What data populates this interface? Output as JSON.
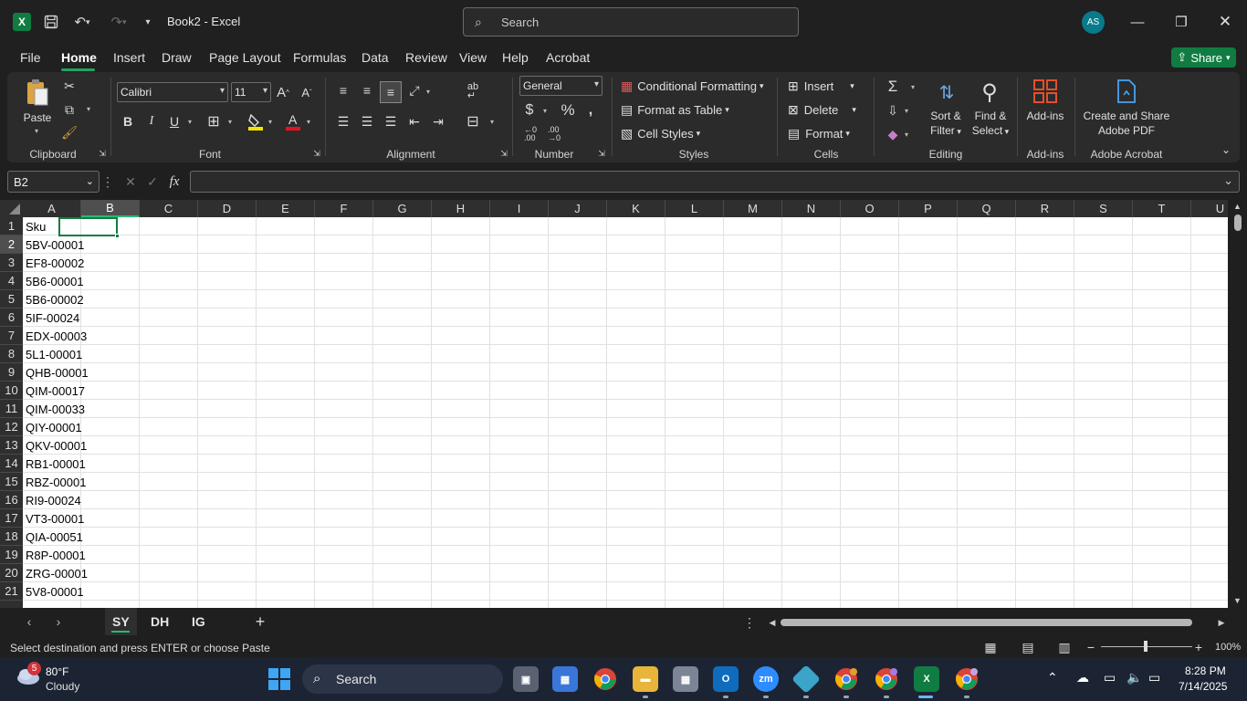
{
  "titlebar": {
    "doc_title": "Book2 - Excel",
    "search_placeholder": "Search",
    "avatar_initials": "AS"
  },
  "menu": {
    "tabs": [
      "File",
      "Home",
      "Insert",
      "Draw",
      "Page Layout",
      "Formulas",
      "Data",
      "Review",
      "View",
      "Help",
      "Acrobat"
    ],
    "active": "Home",
    "share_label": "Share"
  },
  "ribbon": {
    "clipboard": {
      "paste_label": "Paste",
      "group_label": "Clipboard"
    },
    "font": {
      "font_name": "Calibri",
      "font_size": "11",
      "bold": "B",
      "italic": "I",
      "underline": "U",
      "group_label": "Font"
    },
    "alignment": {
      "group_label": "Alignment"
    },
    "number": {
      "format": "General",
      "group_label": "Number"
    },
    "styles": {
      "conditional": "Conditional Formatting",
      "format_table": "Format as Table",
      "cell_styles": "Cell Styles",
      "group_label": "Styles"
    },
    "cells": {
      "insert": "Insert",
      "delete": "Delete",
      "format": "Format",
      "group_label": "Cells"
    },
    "editing": {
      "sort_filter_1": "Sort &",
      "sort_filter_2": "Filter",
      "find_select_1": "Find &",
      "find_select_2": "Select",
      "group_label": "Editing"
    },
    "addins": {
      "label": "Add-ins",
      "group_label": "Add-ins"
    },
    "acrobat": {
      "label_1": "Create and Share",
      "label_2": "Adobe PDF",
      "group_label": "Adobe Acrobat"
    }
  },
  "formula_bar": {
    "name_box": "B2",
    "fx": "fx",
    "value": ""
  },
  "grid": {
    "columns": [
      "A",
      "B",
      "C",
      "D",
      "E",
      "F",
      "G",
      "H",
      "I",
      "J",
      "K",
      "L",
      "M",
      "N",
      "O",
      "P",
      "Q",
      "R",
      "S",
      "T",
      "U"
    ],
    "selected_column": "B",
    "selected_row": "2",
    "rows": [
      {
        "n": "1",
        "a": "Sku"
      },
      {
        "n": "2",
        "a": "5BV-00001"
      },
      {
        "n": "3",
        "a": "EF8-00002"
      },
      {
        "n": "4",
        "a": "5B6-00001"
      },
      {
        "n": "5",
        "a": "5B6-00002"
      },
      {
        "n": "6",
        "a": "5IF-00024"
      },
      {
        "n": "7",
        "a": "EDX-00003"
      },
      {
        "n": "8",
        "a": "5L1-00001"
      },
      {
        "n": "9",
        "a": "QHB-00001"
      },
      {
        "n": "10",
        "a": "QIM-00017"
      },
      {
        "n": "11",
        "a": "QIM-00033"
      },
      {
        "n": "12",
        "a": "QIY-00001"
      },
      {
        "n": "13",
        "a": "QKV-00001"
      },
      {
        "n": "14",
        "a": "RB1-00001"
      },
      {
        "n": "15",
        "a": "RBZ-00001"
      },
      {
        "n": "16",
        "a": "RI9-00024"
      },
      {
        "n": "17",
        "a": "VT3-00001"
      },
      {
        "n": "18",
        "a": "QIA-00051"
      },
      {
        "n": "19",
        "a": "R8P-00001"
      },
      {
        "n": "20",
        "a": "ZRG-00001"
      },
      {
        "n": "21",
        "a": "5V8-00001"
      }
    ]
  },
  "sheets": {
    "tabs": [
      "SY",
      "DH",
      "IG"
    ],
    "active": "SY"
  },
  "status": {
    "message": "Select destination and press ENTER or choose Paste",
    "zoom": "100%"
  },
  "taskbar": {
    "weather_temp": "80°F",
    "weather_cond": "Cloudy",
    "weather_badge": "5",
    "search_label": "Search",
    "time": "8:28 PM",
    "date": "7/14/2025"
  }
}
